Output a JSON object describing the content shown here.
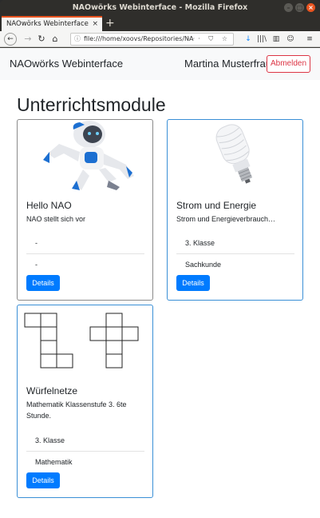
{
  "window": {
    "title": "NAOwörks Webinterface - Mozilla Firefox"
  },
  "tab": {
    "title": "NAOwörks Webinterface",
    "close": "×",
    "new_tab": "+"
  },
  "navigation": {
    "back": "←",
    "forward": "→",
    "reload": "↻",
    "home": "⌂",
    "url_info": "ⓘ",
    "url": "file:///home/xoovs/Repositories/NA",
    "url_tools": "··· ⛉ ☆",
    "download": "↓",
    "library": "|||\\",
    "sidebar": "▥",
    "account": "☺",
    "menu": "≡"
  },
  "site": {
    "brand": "NAOwörks Webinterface",
    "user": "Martina Musterfrau",
    "logout_label": "Abmelden",
    "heading": "Unterrichtsmodule"
  },
  "cards": [
    {
      "title": "Hello NAO",
      "text": "NAO stellt sich vor",
      "item1": "-",
      "item2": "-",
      "button": "Details",
      "image": "nao-robot",
      "border": "#8a8a8a"
    },
    {
      "title": "Strom und Energie",
      "text": "Strom und Energieverbrauch…",
      "item1": "3. Klasse",
      "item2": "Sachkunde",
      "button": "Details",
      "image": "light-bulb",
      "border": "#3a8fd6"
    },
    {
      "title": "Würfelnetze",
      "text": "Mathematik Klassenstufe 3. 6te Stunde.",
      "item1": "3. Klasse",
      "item2": "Mathematik",
      "button": "Details",
      "image": "cube-nets",
      "border": "#3a8fd6"
    }
  ],
  "colors": {
    "primary": "#007bff",
    "danger": "#dc3545",
    "ubuntu_orange": "#e95420"
  }
}
